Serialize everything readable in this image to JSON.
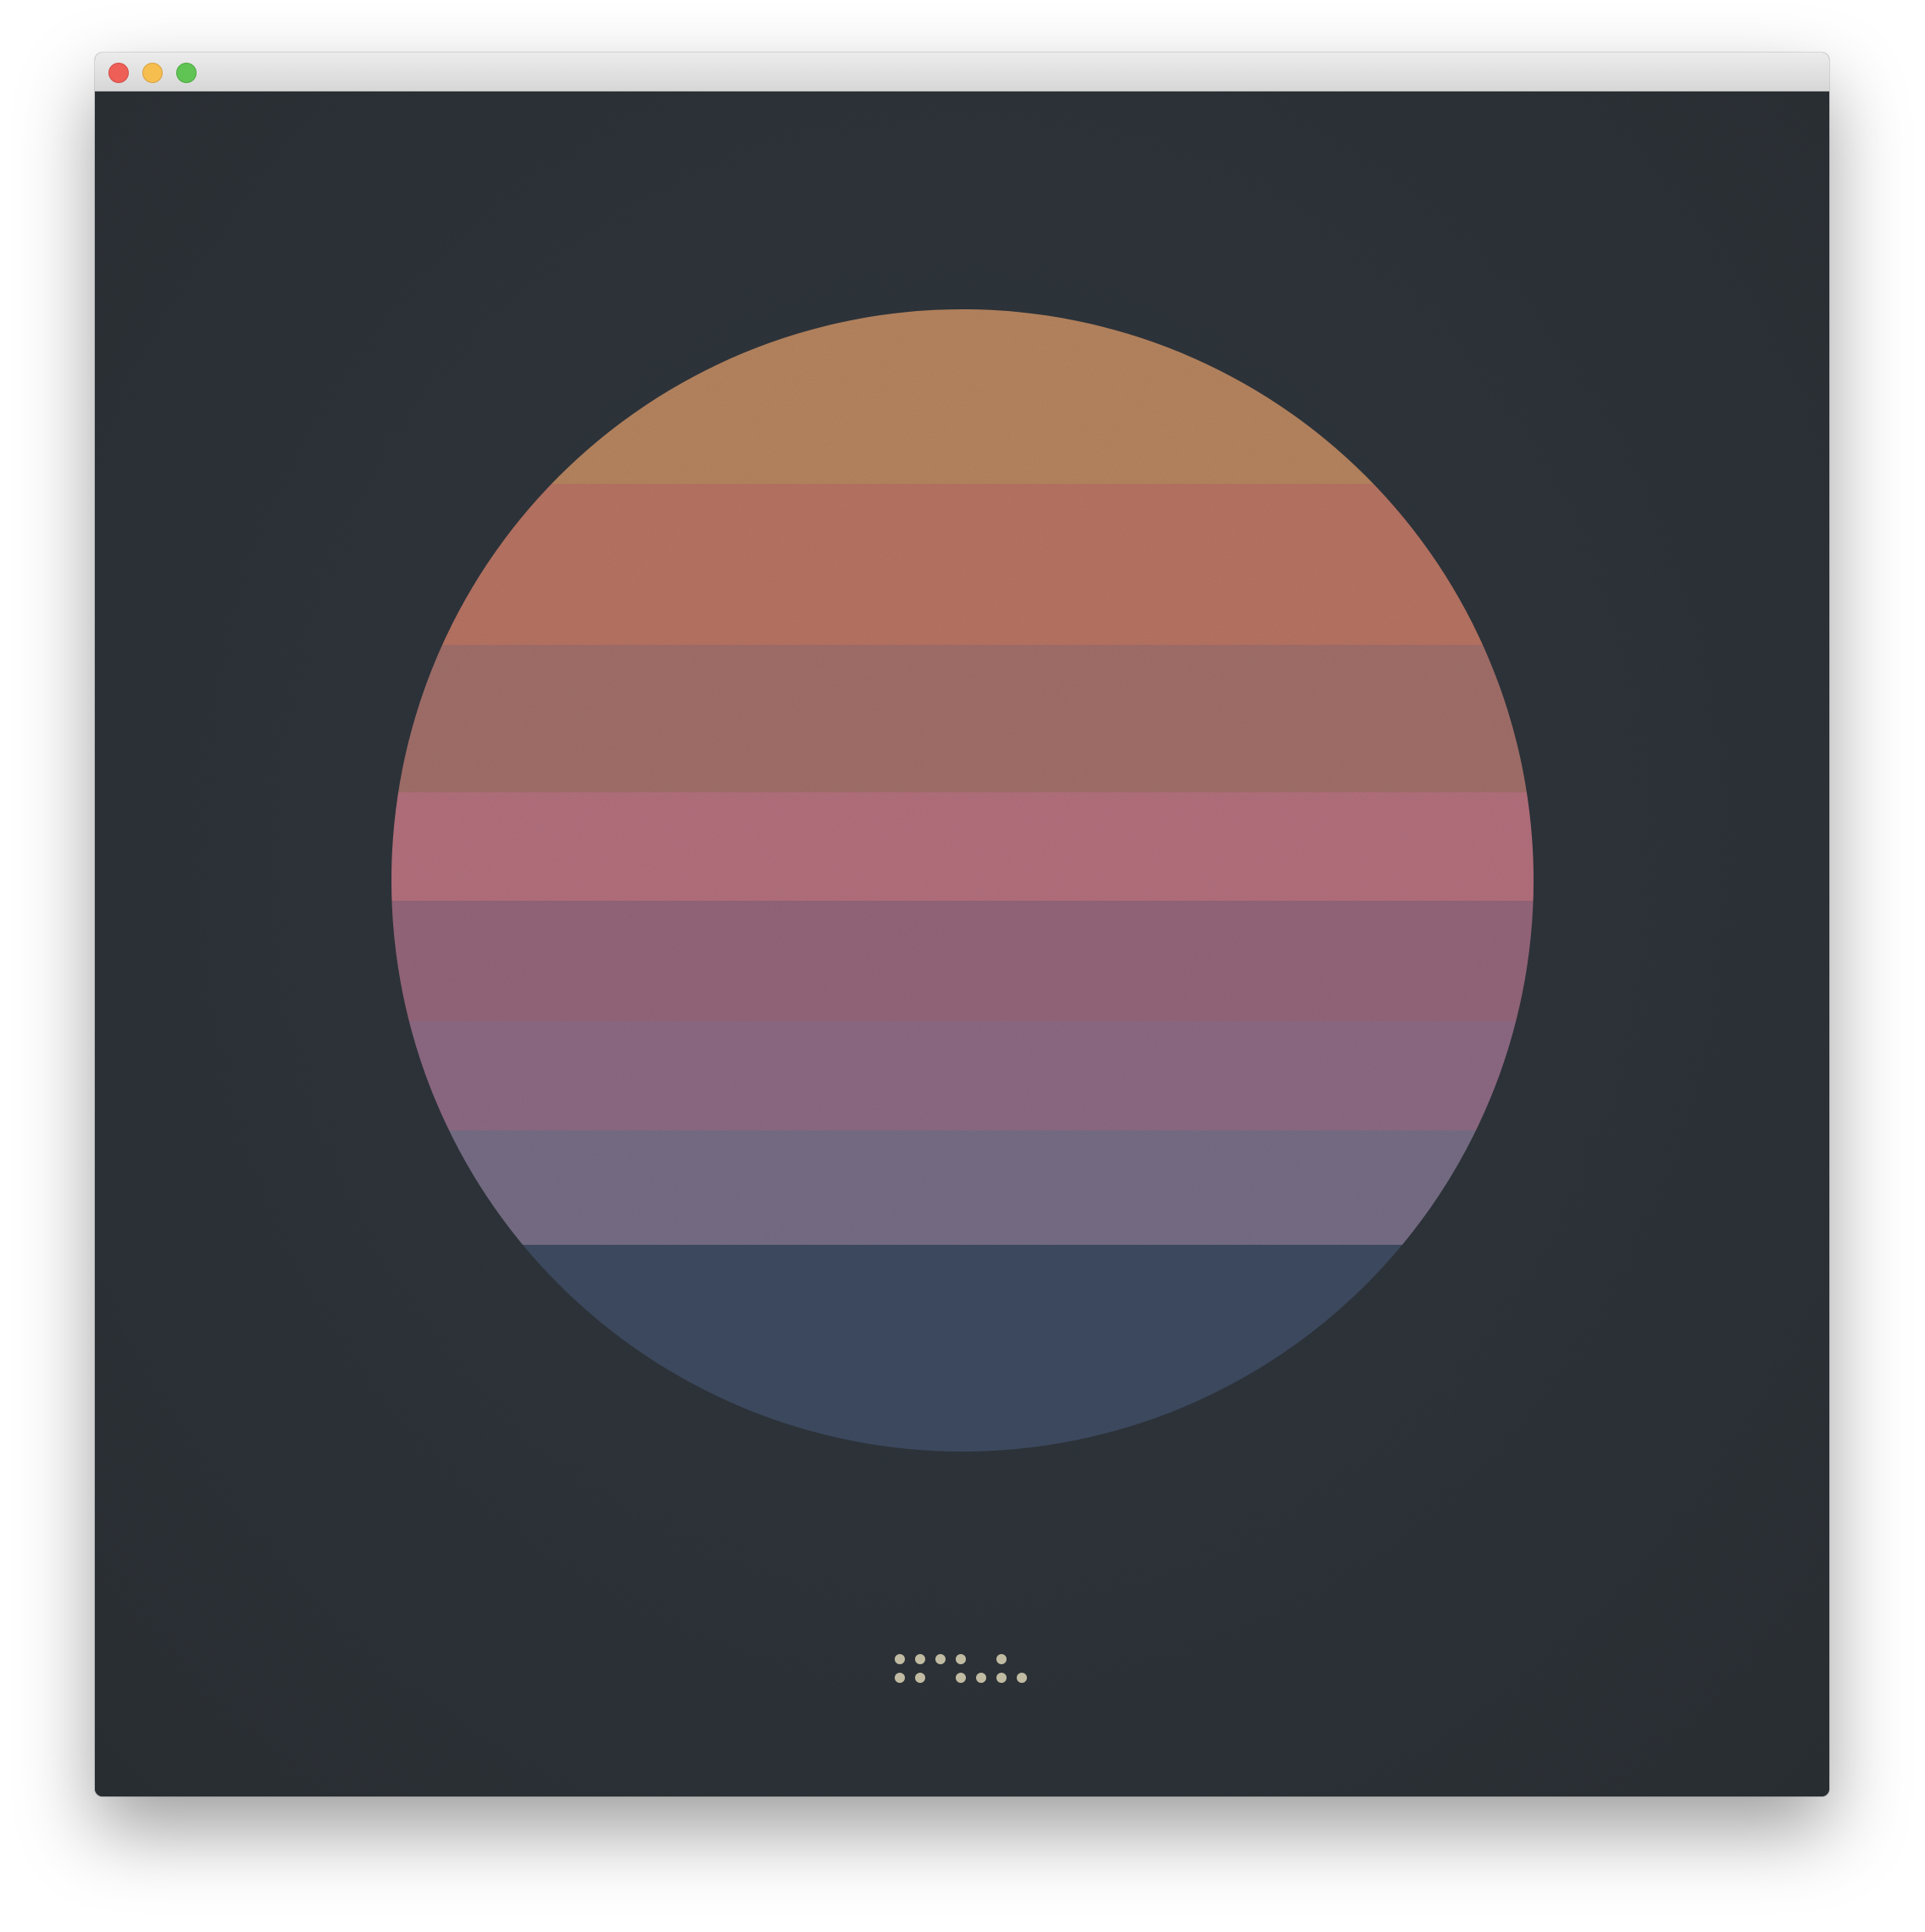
{
  "window": {
    "title": "",
    "controls": {
      "close_icon": "close-icon",
      "minimize_icon": "minimize-icon",
      "maximize_icon": "maximize-icon"
    }
  },
  "artwork": {
    "background_color": "#2e343a",
    "stripes": [
      {
        "color": "#b78560"
      },
      {
        "color": "#b87463"
      },
      {
        "color": "#a26f6a"
      },
      {
        "color": "#b4707d"
      },
      {
        "color": "#95667a"
      },
      {
        "color": "#8e6a84"
      },
      {
        "color": "#776e86"
      },
      {
        "color": "#3e4b61"
      }
    ],
    "braille_mark_color": "#c9c3a9"
  }
}
